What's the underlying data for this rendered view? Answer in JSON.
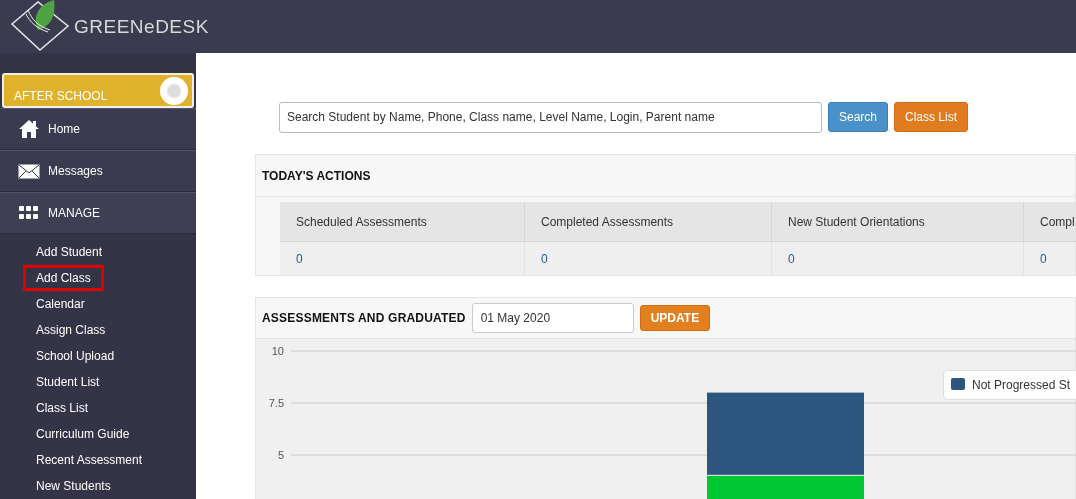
{
  "logo": {
    "text": "GREENeDESK"
  },
  "sidebar": {
    "mode_switch": {
      "label": "AFTER SCHOOL",
      "on": true
    },
    "items": [
      {
        "kind": "nav",
        "label": "Home"
      },
      {
        "kind": "nav",
        "label": "Messages"
      },
      {
        "kind": "section",
        "label": "MANAGE",
        "children": [
          {
            "label": "Add Student",
            "highlighted": false
          },
          {
            "label": "Add Class",
            "highlighted": true
          },
          {
            "label": "Calendar",
            "highlighted": false
          },
          {
            "label": "Assign Class",
            "highlighted": false
          },
          {
            "label": "School Upload",
            "highlighted": false
          },
          {
            "label": "Student List",
            "highlighted": false
          },
          {
            "label": "Class List",
            "highlighted": false
          },
          {
            "label": "Curriculum Guide",
            "highlighted": false
          },
          {
            "label": "Recent Assessment",
            "highlighted": false
          },
          {
            "label": "New Students",
            "highlighted": false
          }
        ]
      }
    ]
  },
  "search": {
    "placeholder": "Search Student by Name, Phone, Class name, Level Name, Login, Parent name"
  },
  "buttons": [
    {
      "kind": "primary",
      "label": "Search"
    },
    {
      "kind": "warning",
      "label": "Class List"
    }
  ],
  "todays_actions": {
    "title": "TODAY'S ACTIONS",
    "columns": [
      "Scheduled Assessments",
      "Completed Assessments",
      "New Student Orientations",
      "Compl"
    ],
    "values": [
      "0",
      "0",
      "0",
      "0"
    ]
  },
  "assessments": {
    "title": "ASSESSMENTS AND GRADUATED",
    "date": "01 May 2020",
    "button": "UPDATE",
    "chart_data": {
      "type": "bar",
      "stacked": true,
      "ylim": [
        0,
        10
      ],
      "yticks": [
        10,
        7.5,
        5
      ],
      "series": [
        {
          "name": "Not Progressed St",
          "color": "#2c5580",
          "values": [
            4
          ]
        },
        {
          "color": "#00c832",
          "values": [
            4
          ]
        }
      ]
    }
  }
}
